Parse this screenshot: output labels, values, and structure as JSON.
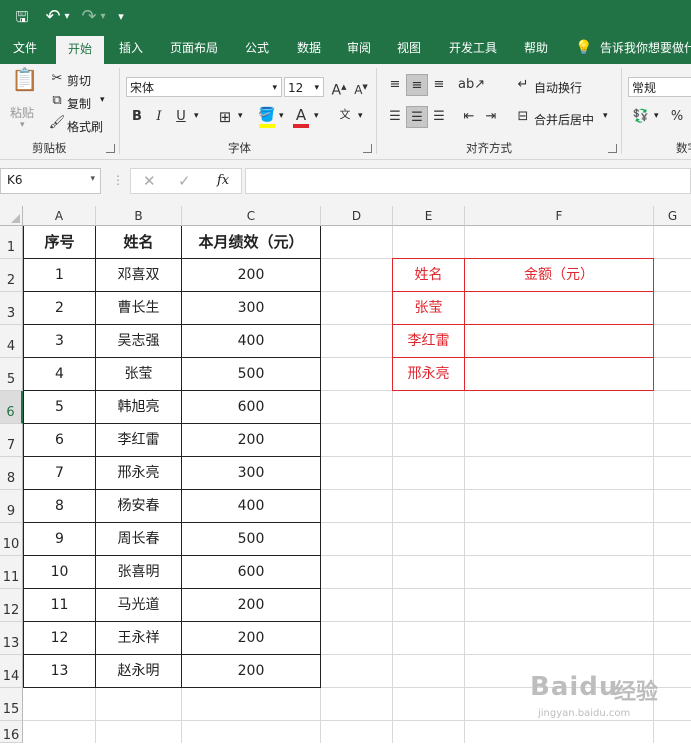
{
  "quick_access": {
    "save": "🖫",
    "undo": "↶",
    "redo": "↷",
    "more": "▾"
  },
  "tabs": [
    "文件",
    "开始",
    "插入",
    "页面布局",
    "公式",
    "数据",
    "审阅",
    "视图",
    "开发工具",
    "帮助"
  ],
  "active_tab": "开始",
  "tell_me": "告诉我你想要做什么",
  "clipboard": {
    "paste": "粘贴",
    "cut": "剪切",
    "copy": "复制",
    "format_painter": "格式刷",
    "group": "剪贴板"
  },
  "font": {
    "name": "宋体",
    "size": "12",
    "bold": "B",
    "italic": "I",
    "underline": "U",
    "group": "字体"
  },
  "alignment": {
    "wrap": "自动换行",
    "merge": "合并后居中",
    "group": "对齐方式"
  },
  "number": {
    "format": "常规",
    "group": "数字"
  },
  "formula_bar": {
    "name_box": "K6",
    "fx": "fx",
    "value": ""
  },
  "columns": [
    "A",
    "B",
    "C",
    "D",
    "E",
    "F",
    "G"
  ],
  "rows": [
    "1",
    "2",
    "3",
    "4",
    "5",
    "6",
    "7",
    "8",
    "9",
    "10",
    "11",
    "12",
    "13",
    "14",
    "15",
    "16"
  ],
  "selected_row": "6",
  "table": {
    "headers": [
      "序号",
      "姓名",
      "本月绩效（元）"
    ],
    "rows": [
      [
        "1",
        "邓喜双",
        "200"
      ],
      [
        "2",
        "曹长生",
        "300"
      ],
      [
        "3",
        "吴志强",
        "400"
      ],
      [
        "4",
        "张莹",
        "500"
      ],
      [
        "5",
        "韩旭亮",
        "600"
      ],
      [
        "6",
        "李红雷",
        "200"
      ],
      [
        "7",
        "邢永亮",
        "300"
      ],
      [
        "8",
        "杨安春",
        "400"
      ],
      [
        "9",
        "周长春",
        "500"
      ],
      [
        "10",
        "张喜明",
        "600"
      ],
      [
        "11",
        "马光道",
        "200"
      ],
      [
        "12",
        "王永祥",
        "200"
      ],
      [
        "13",
        "赵永明",
        "200"
      ]
    ]
  },
  "lookup": {
    "headers": [
      "姓名",
      "金额（元）"
    ],
    "names": [
      "张莹",
      "李红雷",
      "邢永亮"
    ]
  },
  "watermark": {
    "brand": "Baidu",
    "cn": "经验",
    "url": "jingyan.baidu.com"
  },
  "colors": {
    "excel_green": "#217346",
    "red": "#e0262d"
  }
}
